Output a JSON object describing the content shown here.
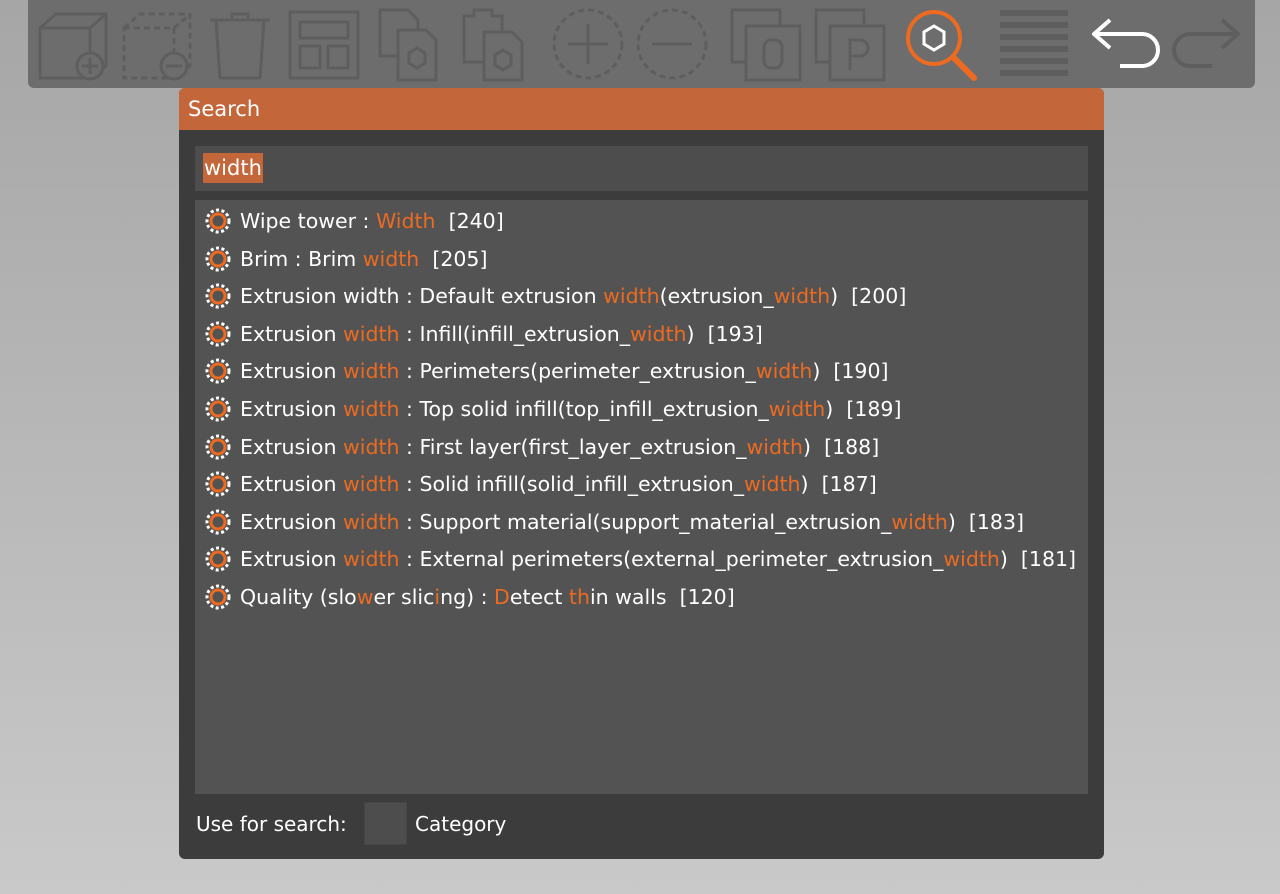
{
  "toolbar": {
    "buttons": [
      {
        "name": "add-object-button",
        "icon": "add-box-icon"
      },
      {
        "name": "remove-object-button",
        "icon": "remove-box-icon"
      },
      {
        "name": "delete-all-button",
        "icon": "trash-icon"
      },
      {
        "name": "arrange-button",
        "icon": "arrange-icon"
      },
      {
        "name": "copy-button",
        "icon": "copy-icon"
      },
      {
        "name": "paste-button",
        "icon": "paste-icon"
      },
      {
        "name": "increase-instances-button",
        "icon": "plus-circle-icon"
      },
      {
        "name": "decrease-instances-button",
        "icon": "minus-circle-icon"
      },
      {
        "name": "split-objects-button",
        "icon": "split-objects-icon"
      },
      {
        "name": "split-parts-button",
        "icon": "split-parts-icon"
      },
      {
        "name": "search-button",
        "icon": "search-icon",
        "active": true
      },
      {
        "name": "layers-editing-button",
        "icon": "layers-icon"
      },
      {
        "name": "undo-button",
        "icon": "undo-icon"
      },
      {
        "name": "redo-button",
        "icon": "redo-icon"
      }
    ],
    "accent": "#ed6b21"
  },
  "search": {
    "title": "Search",
    "query": "width",
    "results": [
      {
        "segments": [
          {
            "t": "Wipe tower : "
          },
          {
            "t": "Width",
            "h": true
          },
          {
            "t": "  [240]"
          }
        ]
      },
      {
        "segments": [
          {
            "t": "Brim : Brim "
          },
          {
            "t": "width",
            "h": true
          },
          {
            "t": "  [205]"
          }
        ]
      },
      {
        "segments": [
          {
            "t": "Extrusion width : Default extrusion "
          },
          {
            "t": "width",
            "h": true
          },
          {
            "t": "(extrusion_"
          },
          {
            "t": "width",
            "h": true
          },
          {
            "t": ")  [200]"
          }
        ]
      },
      {
        "segments": [
          {
            "t": "Extrusion "
          },
          {
            "t": "width",
            "h": true
          },
          {
            "t": " : Infill(infill_extrusion_"
          },
          {
            "t": "width",
            "h": true
          },
          {
            "t": ")  [193]"
          }
        ]
      },
      {
        "segments": [
          {
            "t": "Extrusion "
          },
          {
            "t": "width",
            "h": true
          },
          {
            "t": " : Perimeters(perimeter_extrusion_"
          },
          {
            "t": "width",
            "h": true
          },
          {
            "t": ")  [190]"
          }
        ]
      },
      {
        "segments": [
          {
            "t": "Extrusion "
          },
          {
            "t": "width",
            "h": true
          },
          {
            "t": " : Top solid infill(top_infill_extrusion_"
          },
          {
            "t": "width",
            "h": true
          },
          {
            "t": ")  [189]"
          }
        ]
      },
      {
        "segments": [
          {
            "t": "Extrusion "
          },
          {
            "t": "width",
            "h": true
          },
          {
            "t": " : First layer(first_layer_extrusion_"
          },
          {
            "t": "width",
            "h": true
          },
          {
            "t": ")  [188]"
          }
        ]
      },
      {
        "segments": [
          {
            "t": "Extrusion "
          },
          {
            "t": "width",
            "h": true
          },
          {
            "t": " : Solid infill(solid_infill_extrusion_"
          },
          {
            "t": "width",
            "h": true
          },
          {
            "t": ")  [187]"
          }
        ]
      },
      {
        "segments": [
          {
            "t": "Extrusion "
          },
          {
            "t": "width",
            "h": true
          },
          {
            "t": " : Support material(support_material_extrusion_"
          },
          {
            "t": "width",
            "h": true
          },
          {
            "t": ")  [183]"
          }
        ]
      },
      {
        "segments": [
          {
            "t": "Extrusion "
          },
          {
            "t": "width",
            "h": true
          },
          {
            "t": " : External perimeters(external_perimeter_extrusion_"
          },
          {
            "t": "width",
            "h": true
          },
          {
            "t": ")  [181]"
          }
        ]
      },
      {
        "segments": [
          {
            "t": "Quality (slo"
          },
          {
            "t": "w",
            "h": true
          },
          {
            "t": "er slic"
          },
          {
            "t": "i",
            "h": true
          },
          {
            "t": "ng) : "
          },
          {
            "t": "D",
            "h": true
          },
          {
            "t": "etect "
          },
          {
            "t": "th",
            "h": true
          },
          {
            "t": "in walls  [120]"
          }
        ]
      }
    ],
    "result_icon": "gear-icon",
    "footer": {
      "label": "Use for search:",
      "checkbox_label": "Category",
      "checkbox_checked": false
    }
  }
}
